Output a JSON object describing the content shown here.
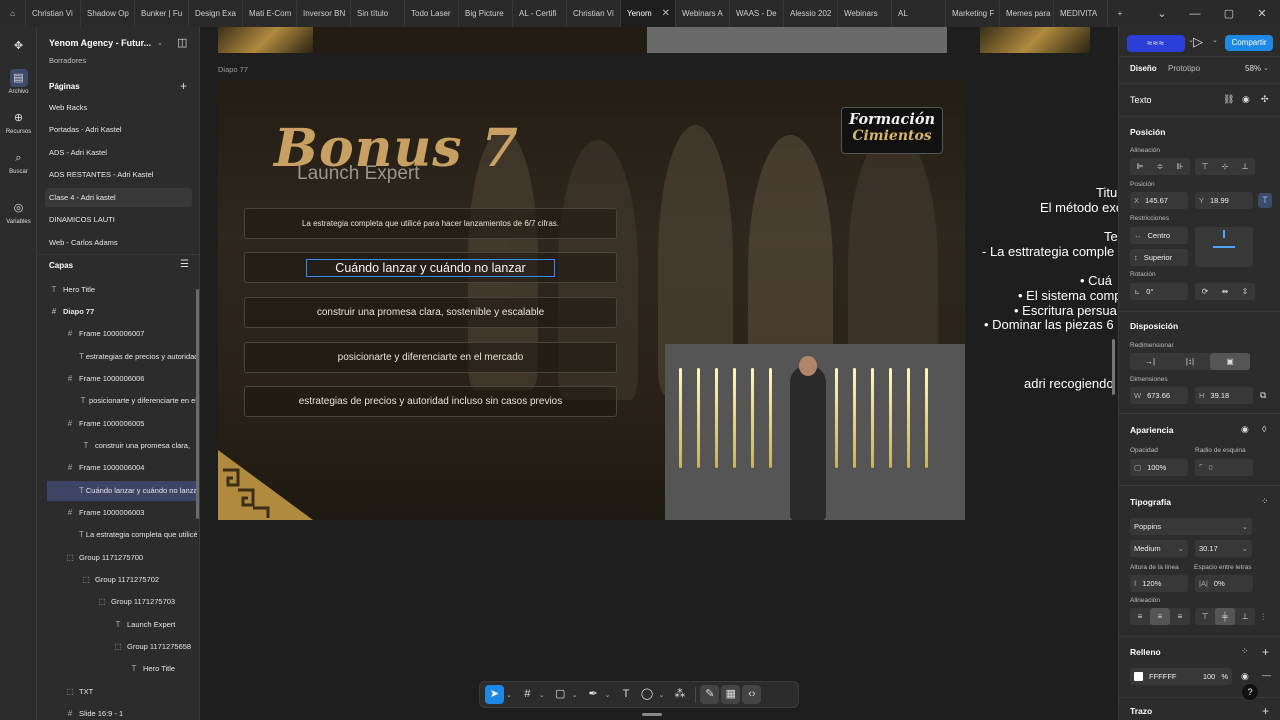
{
  "tabs": [
    {
      "label": "Christian Vi"
    },
    {
      "label": "Shadow Op"
    },
    {
      "label": "Bunker | Fu"
    },
    {
      "label": "Design Exa"
    },
    {
      "label": "Mati E-Com"
    },
    {
      "label": "Inversor BN"
    },
    {
      "label": "Sin título"
    },
    {
      "label": "Todo Laser"
    },
    {
      "label": "Big Picture"
    },
    {
      "label": "AL - Certifi"
    },
    {
      "label": "Christian Vi"
    },
    {
      "label": "Yenom"
    },
    {
      "label": "Webinars A"
    },
    {
      "label": "WAAS - De"
    },
    {
      "label": "Alessio 202"
    },
    {
      "label": "Webinars"
    },
    {
      "label": "AL"
    },
    {
      "label": "Marketing F"
    },
    {
      "label": "Memes para"
    },
    {
      "label": "MEDIVITA"
    }
  ],
  "rail": {
    "archivo": "Archivo",
    "recursos": "Recursos",
    "buscar": "Buscar",
    "variables": "Variables"
  },
  "project": {
    "name": "Yenom Agency - Futur...",
    "sub": "Borradores"
  },
  "pages": {
    "header": "Páginas",
    "items": [
      {
        "label": "Web Racks"
      },
      {
        "label": "Portadas - Adri Kastel"
      },
      {
        "label": "ADS - Adri Kastel"
      },
      {
        "label": "ADS RESTANTES - Adri Kastel"
      },
      {
        "label": "Clase 4 - Adri kastel"
      },
      {
        "label": "DINAMICOS LAUTI"
      },
      {
        "label": "Web - Carlos Adams"
      }
    ]
  },
  "layers": {
    "header": "Capas",
    "items": [
      {
        "label": "Hero Title"
      },
      {
        "label": "Diapo 77"
      },
      {
        "label": "Frame 1000006007"
      },
      {
        "label": "estrategias de precios y autoridad"
      },
      {
        "label": "Frame 1000006006"
      },
      {
        "label": "posicionarte y diferenciarte en el"
      },
      {
        "label": "Frame 1000006005"
      },
      {
        "label": "construir una promesa clara,"
      },
      {
        "label": "Frame 1000006004"
      },
      {
        "label": "Cuándo lanzar y cuándo no lanzar"
      },
      {
        "label": "Frame 1000006003"
      },
      {
        "label": "La estrategia completa que utilicé"
      },
      {
        "label": "Group 1171275700"
      },
      {
        "label": "Group 1171275702"
      },
      {
        "label": "Group 1171275703"
      },
      {
        "label": "Launch Expert"
      },
      {
        "label": "Group 1171275658"
      },
      {
        "label": "Hero Title"
      },
      {
        "label": "TXT"
      },
      {
        "label": "Slide 16:9 - 1"
      }
    ]
  },
  "canvas": {
    "frame_label": "Diapo 77",
    "brand_line1": "Formación",
    "brand_line2": "Cimientos",
    "bonus_title": "Bonus 7",
    "bonus_sub": "Launch Expert",
    "rows": [
      {
        "text": "La estrategia completa que utilicé para hacer lanzamientos de 6/7 cifras."
      },
      {
        "text": "Cuándo lanzar y cuándo no lanzar"
      },
      {
        "text": "construir una promesa clara, sostenible y escalable"
      },
      {
        "text": "posicionarte y diferenciarte en el mercado"
      },
      {
        "text": "estrategias de precios y autoridad incluso sin casos previos"
      }
    ],
    "offcanvas": [
      {
        "text": "Titu"
      },
      {
        "text": "El método exc"
      },
      {
        "text": "Te"
      },
      {
        "text": "- La esttrategia comple"
      },
      {
        "text": "• Cuá"
      },
      {
        "text": "• El sistema comp"
      },
      {
        "text": "• Escritura persua"
      },
      {
        "text": "• Dominar las piezas 6"
      },
      {
        "text": "adri recogiendo"
      }
    ]
  },
  "right": {
    "share": "Compartir",
    "tab_design": "Diseño",
    "tab_prototype": "Prototipo",
    "zoom": "58%",
    "text_header": "Texto",
    "position": "Posición",
    "alignment": "Alineación",
    "position_label": "Posición",
    "x_label": "X",
    "x": "145.67",
    "y_label": "Y",
    "y": "18.99",
    "constraints": "Restricciones",
    "c_h": "Centro",
    "c_v": "Superior",
    "rotation": "Rotación",
    "rotation_value": "0°",
    "layout": "Disposición",
    "resize": "Redimensionar",
    "dimensions": "Dimensiones",
    "w_label": "W",
    "w": "673.66",
    "h_label": "H",
    "h": "39.18",
    "appearance": "Apariencia",
    "opacity": "Opacidad",
    "opacity_value": "100%",
    "radius": "Radio de esquina",
    "radius_value": "0",
    "typography": "Tipografía",
    "font": "Poppins",
    "weight": "Medium",
    "size": "30.17",
    "line_height": "Altura de la línea",
    "line_height_value": "120%",
    "letter_spacing": "Espacio entre letras",
    "letter_spacing_value": "0%",
    "text_align": "Alineación",
    "fill": "Relleno",
    "fill_hex": "FFFFFF",
    "fill_opacity": "100",
    "fill_pct": "%",
    "stroke": "Trazo"
  }
}
